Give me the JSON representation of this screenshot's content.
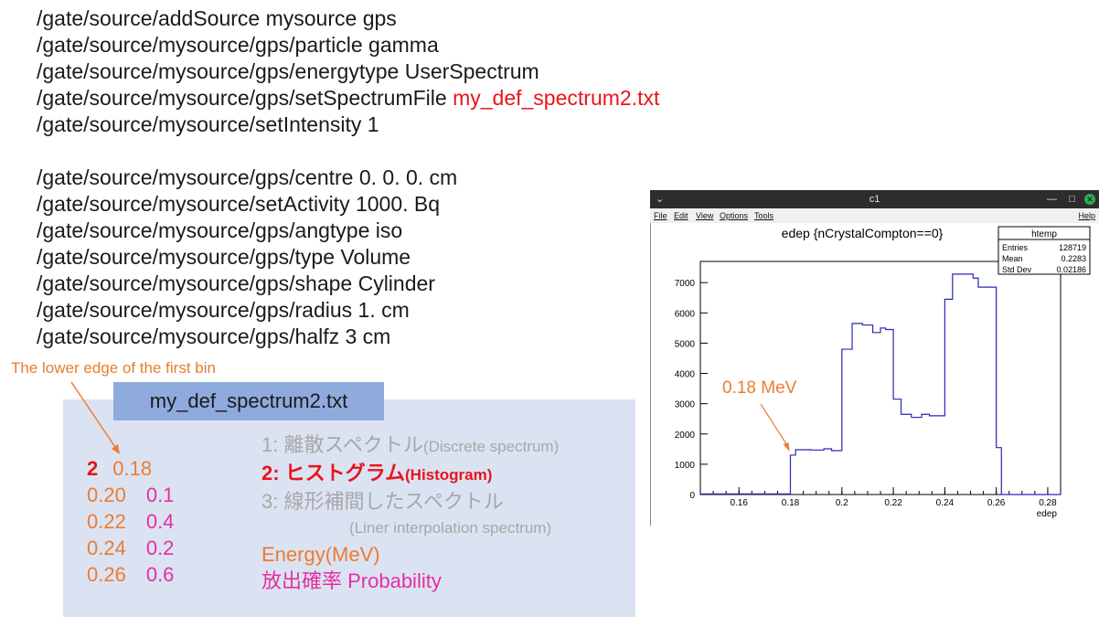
{
  "commands_block1": [
    {
      "text": "/gate/source/addSource mysource gps",
      "highlight": ""
    },
    {
      "text": "/gate/source/mysource/gps/particle gamma",
      "highlight": ""
    },
    {
      "text": "/gate/source/mysource/gps/energytype UserSpectrum",
      "highlight": ""
    },
    {
      "text": "/gate/source/mysource/gps/setSpectrumFile ",
      "highlight": "my_def_spectrum2.txt"
    },
    {
      "text": "/gate/source/mysource/setIntensity 1",
      "highlight": ""
    }
  ],
  "commands_block2": [
    "/gate/source/mysource/gps/centre 0. 0. 0. cm",
    "/gate/source/mysource/setActivity 1000. Bq",
    "/gate/source/mysource/gps/angtype iso",
    "/gate/source/mysource/gps/type Volume",
    "/gate/source/mysource/gps/shape Cylinder",
    "/gate/source/mysource/gps/radius 1. cm",
    "/gate/source/mysource/gps/halfz 3 cm"
  ],
  "annotation_first_bin": "The lower edge of the first bin",
  "spectrum_file": {
    "filename": "my_def_spectrum2.txt",
    "mode": "2",
    "first_edge": "0.18",
    "rows": [
      {
        "energy": "0.20",
        "prob": "0.1"
      },
      {
        "energy": "0.22",
        "prob": "0.4"
      },
      {
        "energy": "0.24",
        "prob": "0.2"
      },
      {
        "energy": "0.26",
        "prob": "0.6"
      }
    ],
    "legend": {
      "mode1": "1: 離散スペクトル",
      "mode1_en": "(Discrete spectrum)",
      "mode2": "2: ヒストグラム",
      "mode2_en": "(Histogram)",
      "mode3": "3: 線形補間したスペクトル",
      "mode3_en": "(Liner interpolation spectrum)",
      "energy_label": "Energy(MeV)",
      "prob_label": "放出確率 Probability"
    }
  },
  "root_window": {
    "title": "c1",
    "menu": [
      "File",
      "Edit",
      "View",
      "Options",
      "Tools"
    ],
    "help": "Help",
    "chevron": "⌄"
  },
  "chart_data": {
    "type": "bar",
    "title": "edep {nCrystalCompton==0}",
    "xlabel": "edep",
    "ylabel": "",
    "xlim": [
      0.145,
      0.285
    ],
    "ylim": [
      0,
      7700
    ],
    "xticks": [
      "0.16",
      "0.18",
      "0.2",
      "0.22",
      "0.24",
      "0.26",
      "0.28"
    ],
    "yticks": [
      "0",
      "1000",
      "2000",
      "3000",
      "4000",
      "5000",
      "6000",
      "7000"
    ],
    "bins": [
      {
        "x0": 0.145,
        "x1": 0.18,
        "y": 20
      },
      {
        "x0": 0.18,
        "x1": 0.182,
        "y": 1300
      },
      {
        "x0": 0.182,
        "x1": 0.188,
        "y": 1480
      },
      {
        "x0": 0.188,
        "x1": 0.193,
        "y": 1470
      },
      {
        "x0": 0.193,
        "x1": 0.196,
        "y": 1510
      },
      {
        "x0": 0.196,
        "x1": 0.2,
        "y": 1450
      },
      {
        "x0": 0.2,
        "x1": 0.204,
        "y": 4800
      },
      {
        "x0": 0.204,
        "x1": 0.208,
        "y": 5650
      },
      {
        "x0": 0.208,
        "x1": 0.212,
        "y": 5600
      },
      {
        "x0": 0.212,
        "x1": 0.215,
        "y": 5350
      },
      {
        "x0": 0.215,
        "x1": 0.217,
        "y": 5500
      },
      {
        "x0": 0.217,
        "x1": 0.22,
        "y": 5450
      },
      {
        "x0": 0.22,
        "x1": 0.223,
        "y": 3150
      },
      {
        "x0": 0.223,
        "x1": 0.227,
        "y": 2650
      },
      {
        "x0": 0.227,
        "x1": 0.231,
        "y": 2550
      },
      {
        "x0": 0.231,
        "x1": 0.234,
        "y": 2650
      },
      {
        "x0": 0.234,
        "x1": 0.24,
        "y": 2600
      },
      {
        "x0": 0.24,
        "x1": 0.243,
        "y": 6450
      },
      {
        "x0": 0.243,
        "x1": 0.251,
        "y": 7280
      },
      {
        "x0": 0.251,
        "x1": 0.253,
        "y": 7150
      },
      {
        "x0": 0.253,
        "x1": 0.26,
        "y": 6850
      },
      {
        "x0": 0.26,
        "x1": 0.262,
        "y": 1550
      },
      {
        "x0": 0.262,
        "x1": 0.285,
        "y": 0
      }
    ],
    "stats": {
      "name": "htemp",
      "rows": [
        {
          "label": "Entries",
          "value": "128719"
        },
        {
          "label": "Mean",
          "value": "0.2283"
        },
        {
          "label": "Std Dev",
          "value": "0.02186"
        }
      ]
    },
    "annotation": {
      "text": "0.18 MeV",
      "x": 0.18,
      "y": 1300
    },
    "line_color": "#2828b4",
    "annotation_color": "#ee7b30"
  }
}
